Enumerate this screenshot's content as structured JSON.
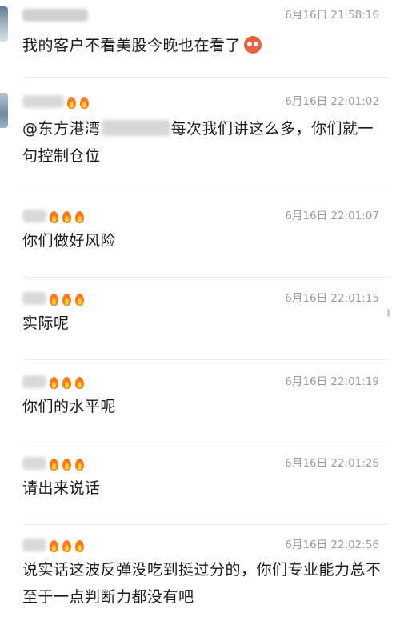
{
  "messages": [
    {
      "time": "6月16日 21:58:16",
      "text": "我的客户不看美股今晚也在看了",
      "emoji": "angry-face",
      "flames": 0
    },
    {
      "time": "6月16日 22:01:02",
      "text_before": "@东方港湾",
      "text_after": "每次我们讲这么多，你们就一句控制仓位",
      "flames": 2
    },
    {
      "time": "6月16日 22:01:07",
      "text": "你们做好风险",
      "flames": 3
    },
    {
      "time": "6月16日 22:01:15",
      "text": "实际呢",
      "flames": 3
    },
    {
      "time": "6月16日 22:01:19",
      "text": "你们的水平呢",
      "flames": 3
    },
    {
      "time": "6月16日 22:01:26",
      "text": "请出来说话",
      "flames": 3
    },
    {
      "time": "6月16日 22:02:56",
      "text": "说实话这波反弹没吃到挺过分的，你们专业能力总不至于一点判断力都没有吧",
      "flames": 3
    }
  ],
  "icons": {
    "flame": "fire-icon",
    "emoji": "angry-face-emoji-icon"
  },
  "colors": {
    "time": "#9a9a9a",
    "text": "#1a1a1a",
    "flame": "#ff7a1a",
    "divider": "#ececec"
  }
}
